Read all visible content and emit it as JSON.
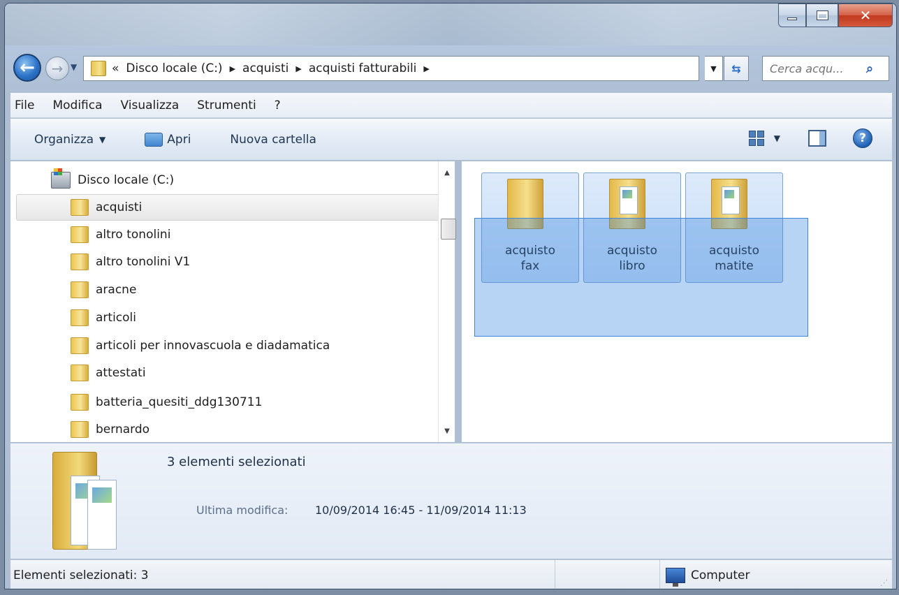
{
  "window": {
    "caption_close": "✕"
  },
  "address_bar": {
    "overflow": "«",
    "crumbs": [
      "Disco locale (C:)",
      "acquisti",
      "acquisti fatturabili"
    ],
    "separator": "▶"
  },
  "search": {
    "placeholder": "Cerca acqu...",
    "icon": "search-icon"
  },
  "menu": {
    "items": [
      "File",
      "Modifica",
      "Visualizza",
      "Strumenti",
      "?"
    ]
  },
  "toolbar": {
    "organize": "Organizza",
    "open": "Apri",
    "new_folder": "Nuova cartella"
  },
  "nav_pane": {
    "root": "Disco locale (C:)",
    "folders": [
      "acquisti",
      "altro tonolini",
      "altro tonolini V1",
      "aracne",
      "articoli",
      "articoli per innovascuola e diadamatica",
      "attestati",
      "batteria_quesiti_ddg130711",
      "bernardo"
    ],
    "selected": "acquisti"
  },
  "content": {
    "items": [
      {
        "line1": "acquisto",
        "line2": "fax"
      },
      {
        "line1": "acquisto",
        "line2": "libro"
      },
      {
        "line1": "acquisto",
        "line2": "matite"
      }
    ]
  },
  "details": {
    "selection_text": "3 elementi selezionati",
    "modified_label": "Ultima modifica:",
    "modified_value": "10/09/2014 16:45 - 11/09/2014 11:13"
  },
  "status": {
    "selected_text": "Elementi selezionati: 3",
    "location": "Computer"
  },
  "colors": {
    "selection_fill": "#3384e0",
    "tile_border": "#7da2ce",
    "close_button": "#c03a1f"
  }
}
